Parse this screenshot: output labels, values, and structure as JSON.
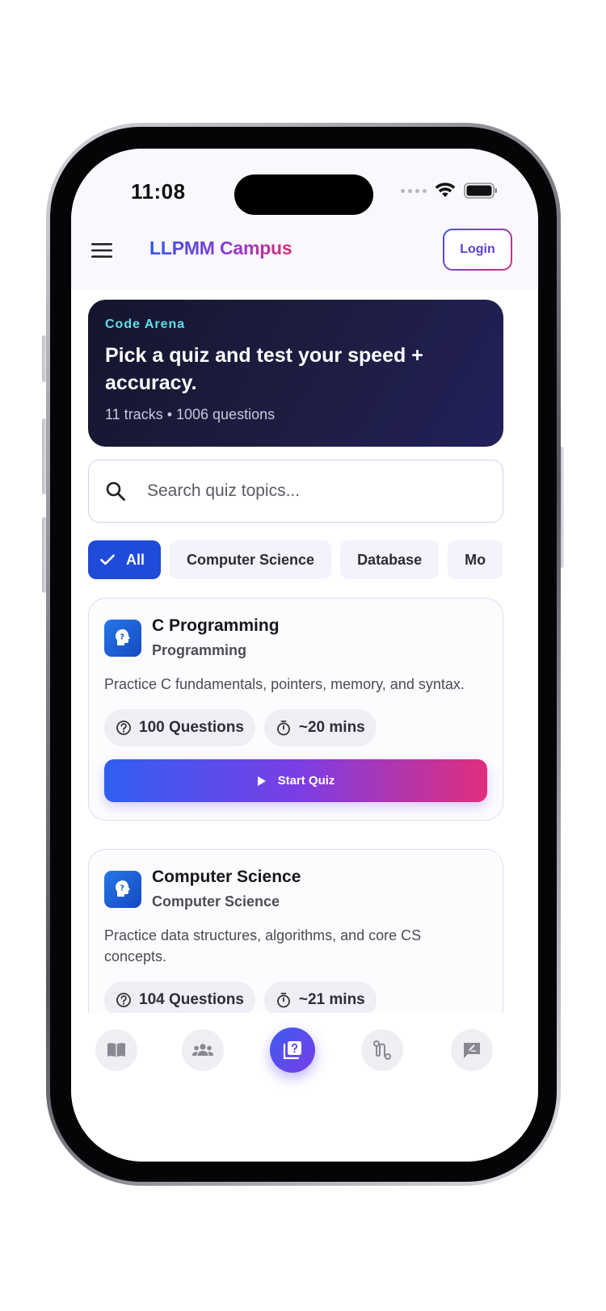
{
  "status_bar": {
    "time": "11:08"
  },
  "header": {
    "brand": "LLPMM Campus",
    "login_label": "Login"
  },
  "hero": {
    "kicker": "Code Arena",
    "title": "Pick a quiz and test your speed + accuracy.",
    "meta": "11 tracks • 1006 questions"
  },
  "search": {
    "placeholder": "Search quiz topics...",
    "value": ""
  },
  "filters": [
    {
      "label": "All",
      "active": true
    },
    {
      "label": "Computer Science",
      "active": false
    },
    {
      "label": "Database",
      "active": false
    },
    {
      "label": "Mo",
      "active": false
    }
  ],
  "quizzes": [
    {
      "title": "C Programming",
      "category": "Programming",
      "description": "Practice C fundamentals, pointers, memory, and syntax.",
      "questions": "100 Questions",
      "duration": "~20 mins",
      "start_label": "Start Quiz"
    },
    {
      "title": "Computer Science",
      "category": "Computer Science",
      "description": "Practice data structures, algorithms, and core CS concepts.",
      "questions": "104 Questions",
      "duration": "~21 mins"
    }
  ],
  "bottom_nav": [
    {
      "icon": "book-icon",
      "active": false
    },
    {
      "icon": "people-icon",
      "active": false
    },
    {
      "icon": "quiz-icon",
      "active": true
    },
    {
      "icon": "route-icon",
      "active": false
    },
    {
      "icon": "feedback-icon",
      "active": false
    }
  ],
  "colors": {
    "accent": "#1f4bd8",
    "hero_bg": "#1a1a3a",
    "hero_kicker": "#5ee0ea",
    "gradient_start": "#2f5ff0",
    "gradient_end": "#e02e7c"
  }
}
